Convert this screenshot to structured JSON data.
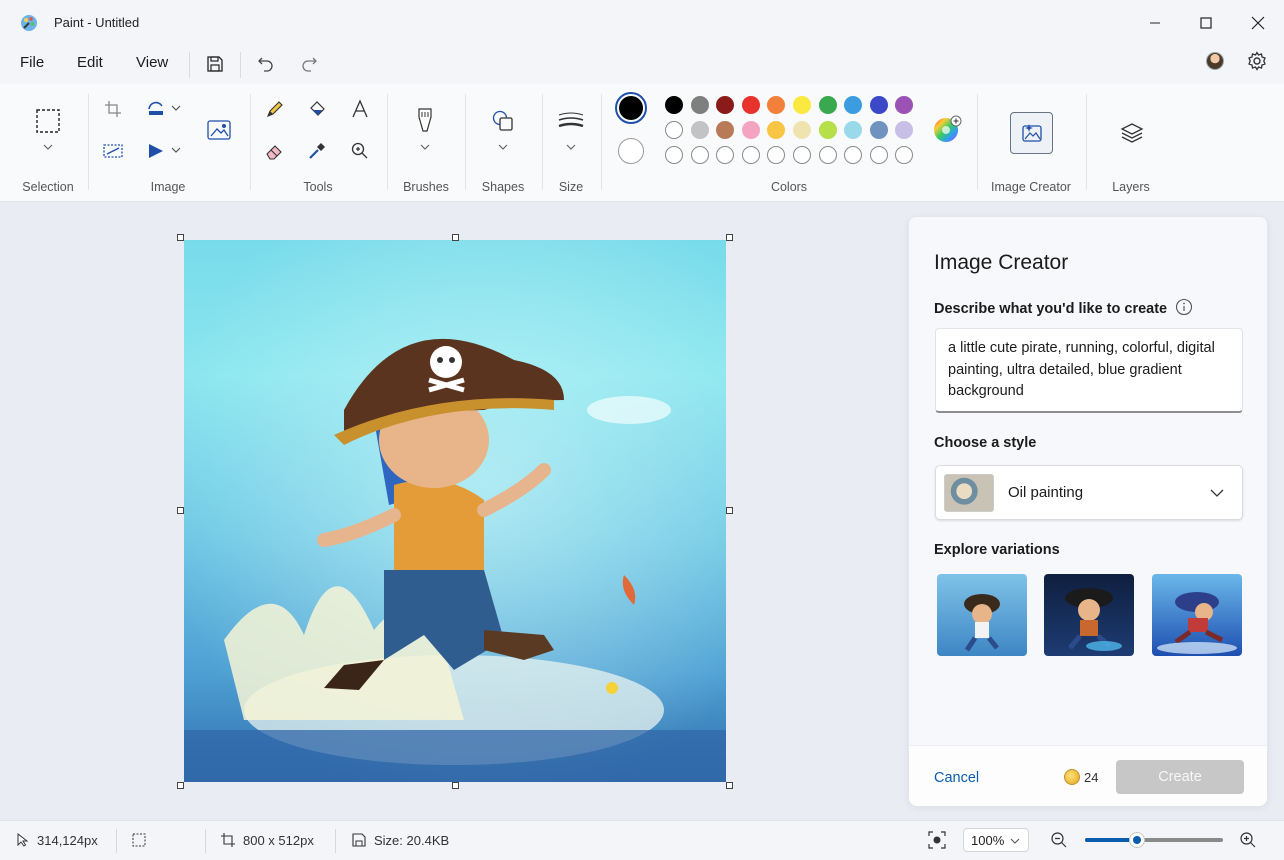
{
  "window": {
    "title": "Paint - Untitled"
  },
  "menu": {
    "file": "File",
    "edit": "Edit",
    "view": "View"
  },
  "ribbon": {
    "groups": {
      "selection": "Selection",
      "image": "Image",
      "tools": "Tools",
      "brushes": "Brushes",
      "shapes": "Shapes",
      "size": "Size",
      "colors": "Colors",
      "image_creator": "Image Creator",
      "layers": "Layers"
    },
    "primary_color": "#000000",
    "secondary_color": "#ffffff",
    "palette_row1": [
      "#000000",
      "#7f7f7f",
      "#8b1a1a",
      "#e8322c",
      "#f2803a",
      "#fbe93f",
      "#3aa84f",
      "#3b9de0",
      "#3b48c8",
      "#9b52b5"
    ],
    "palette_row2": [
      "#ffffff",
      "#c3c3c3",
      "#b97a57",
      "#f4a4c0",
      "#f9c544",
      "#efe4b0",
      "#b5e04a",
      "#99d9ea",
      "#7092be",
      "#c8bfe7"
    ],
    "palette_row3_count": 10
  },
  "panel": {
    "title": "Image Creator",
    "describe_label": "Describe what you'd like to create",
    "prompt": "a little cute pirate, running, colorful, digital painting, ultra detailed, blue gradient background",
    "style_label": "Choose a style",
    "style_value": "Oil painting",
    "variations_label": "Explore variations",
    "cancel": "Cancel",
    "credits": "24",
    "create": "Create"
  },
  "status": {
    "cursor": "314,124px",
    "canvas_size": "800  x  512px",
    "file_size": "Size: 20.4KB",
    "zoom": "100%",
    "zoom_slider": 0.38
  }
}
